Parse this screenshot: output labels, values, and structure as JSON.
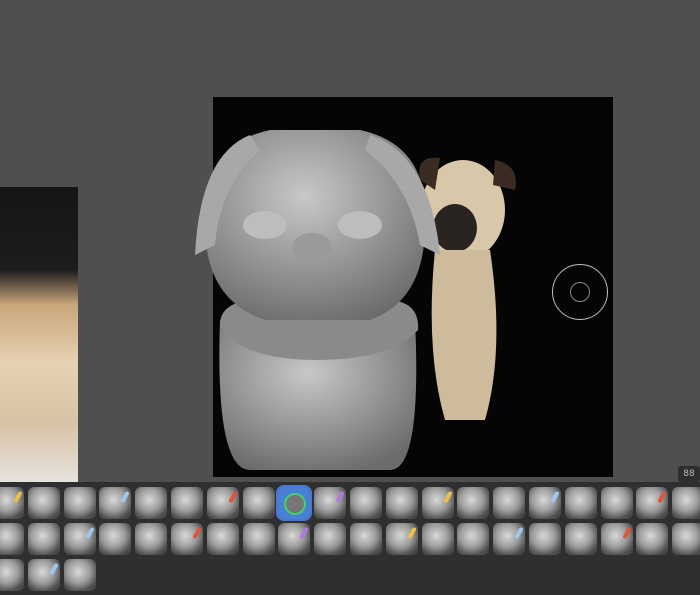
{
  "viewport": {
    "background": "#4f4f4f",
    "reference_images": [
      "pug-photo-left",
      "pug-photo-right"
    ],
    "gizmo": "orbit-circle"
  },
  "layout_button": {
    "icon": "grid-layout-icon",
    "label": "88"
  },
  "palette": {
    "selected_index": 8,
    "selected_color": "#4a78d0",
    "rows": [
      [
        "smooth",
        "clay-blobs",
        "mask-lasso",
        "crease",
        "clay-strips",
        "flatten",
        "pinch",
        "layer",
        "stamp-selected",
        "inflate",
        "snake-hook",
        "twist",
        "cone",
        "drag",
        "planar-cut",
        "texture",
        "vertex-paint",
        "move-x",
        "trim",
        "fill"
      ],
      [
        "blob",
        "mask-pen",
        "draw-curve",
        "soft-blur",
        "scribble-a",
        "scribble-b",
        "wave",
        "zigzag",
        "chalk",
        "nudge",
        "radial",
        "elastic",
        "slice",
        "curve-tube",
        "curve-hook",
        "flower",
        "mesh-grid",
        "mesh-box",
        "flat-knife",
        "noise"
      ],
      [
        "cut",
        "spiral",
        "tangle"
      ]
    ]
  }
}
